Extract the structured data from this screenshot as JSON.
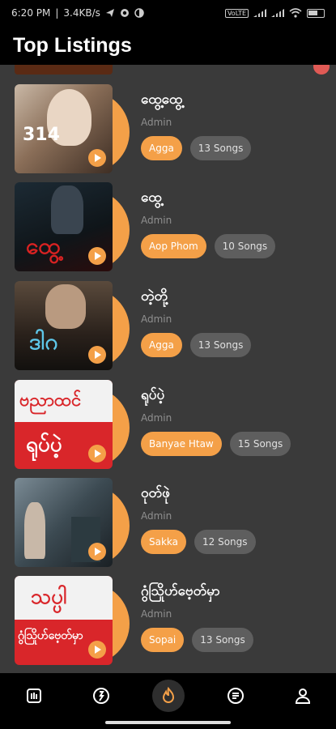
{
  "status_bar": {
    "time": "6:20 PM",
    "speed": "3.4KB/s",
    "volte_label": "VoLTE",
    "battery_level": 0.5
  },
  "header": {
    "title": "Top Listings"
  },
  "items": [
    {
      "title": "ထွေ့ထွေ့",
      "owner": "Admin",
      "artist": "Agga",
      "songs": "13 Songs",
      "art_text": "314"
    },
    {
      "title": "ထွေ့",
      "owner": "Admin",
      "artist": "Aop Phom",
      "songs": "10 Songs",
      "art_text": "ထွေ့"
    },
    {
      "title": "တဲ့တို့",
      "owner": "Admin",
      "artist": "Agga",
      "songs": "13 Songs",
      "art_text": "ဒါဂ"
    },
    {
      "title": "ရုပ်ပဲ့",
      "owner": "Admin",
      "artist": "Banyae Htaw",
      "songs": "15 Songs",
      "art_text_1": "ဗညာထင်",
      "art_text_2": "ရုပ်ပဲ့"
    },
    {
      "title": "ဝုတ်ဖုဲ",
      "owner": "Admin",
      "artist": "Sakka",
      "songs": "12 Songs"
    },
    {
      "title": "ဂွံသြိုဟ်ဗေ့တ်မှာ",
      "owner": "Admin",
      "artist": "Sopai",
      "songs": "13 Songs",
      "art_text_1": "သပ္ပါ",
      "art_text_2": "ဂွံသြိုဟ်ဗေ့တ်မှာ"
    }
  ],
  "nav": [
    {
      "name": "library-icon"
    },
    {
      "name": "artist-icon"
    },
    {
      "name": "fire-icon",
      "active": true
    },
    {
      "name": "playlist-icon"
    },
    {
      "name": "profile-icon"
    }
  ],
  "colors": {
    "accent": "#f4a048",
    "background": "#3a3a3a",
    "chip_gray": "#5e5e5e"
  }
}
